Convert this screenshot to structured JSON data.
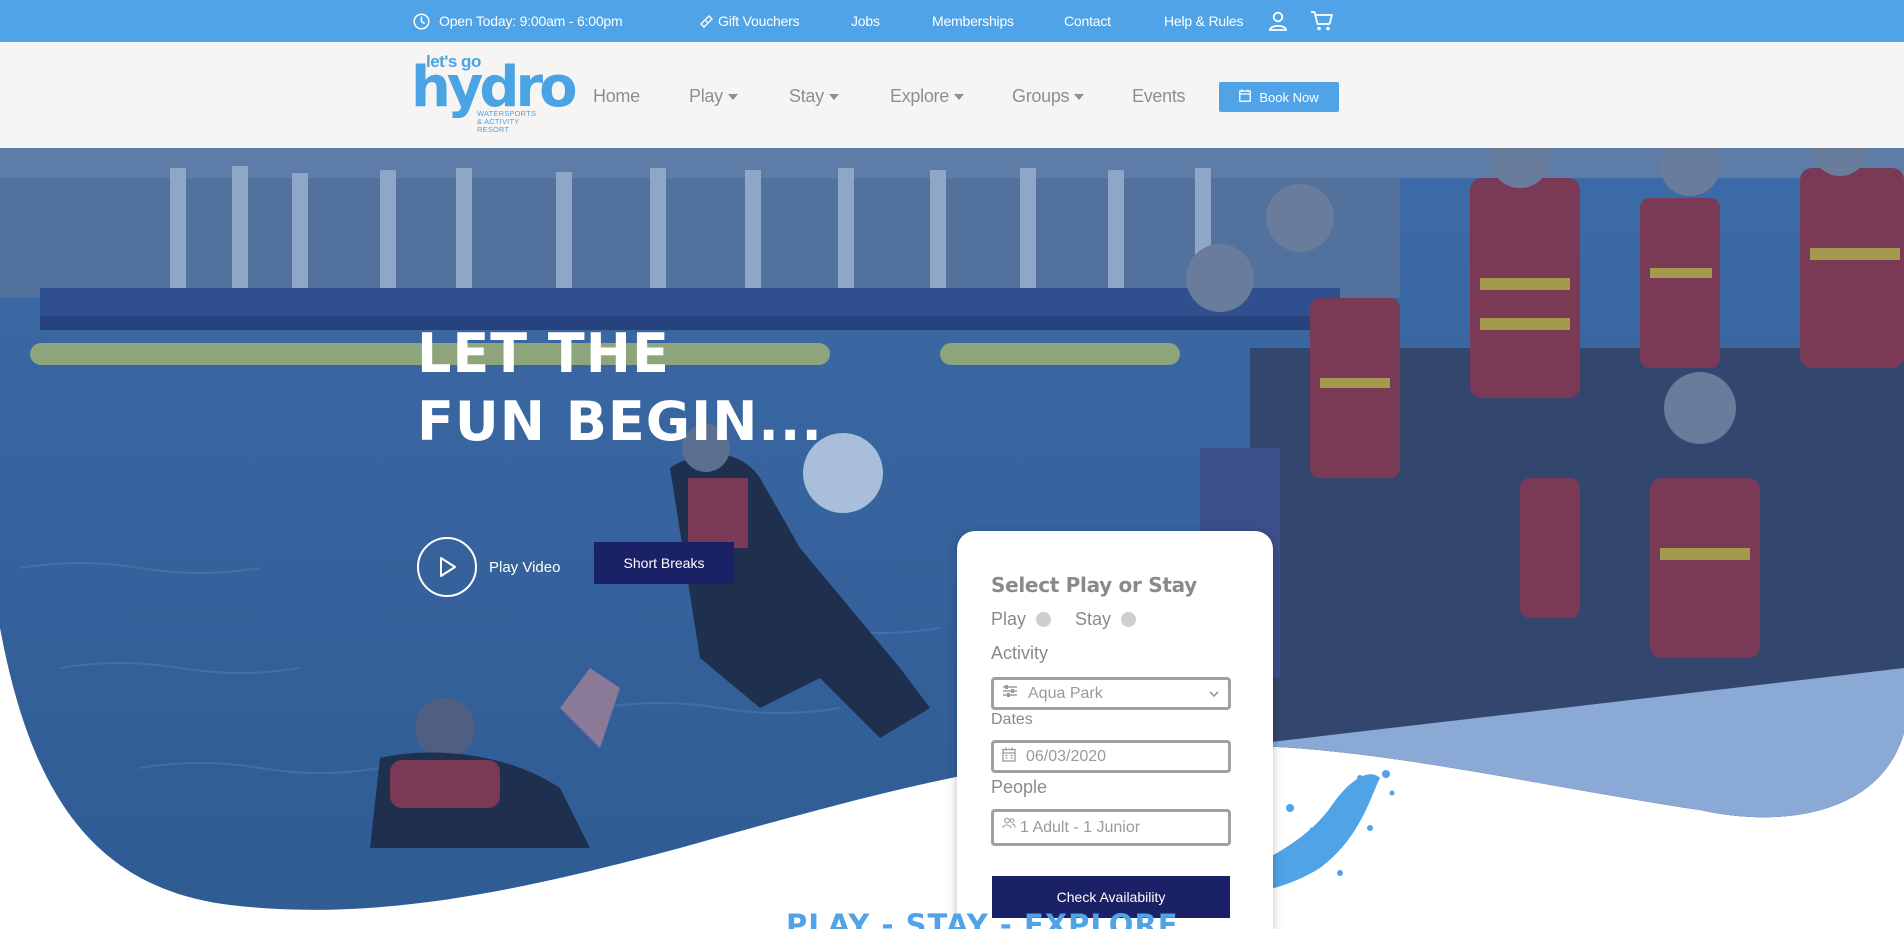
{
  "topbar": {
    "open_today": "Open Today: 9:00am - 6:00pm",
    "links": [
      "Gift Vouchers",
      "Jobs",
      "Memberships",
      "Contact",
      "Help & Rules"
    ]
  },
  "logo": {
    "lets_go": "let's go",
    "hydro": "hydro",
    "tagline_1": "WATERSPORTS",
    "tagline_2": "& ACTIVITY",
    "tagline_3": "RESORT"
  },
  "nav": {
    "items": [
      "Home",
      "Play",
      "Stay",
      "Explore",
      "Groups",
      "Events"
    ],
    "book_now": "Book Now"
  },
  "hero": {
    "headline_line1": "LET THE",
    "headline_line2": "FUN BEGIN...",
    "play_video": "Play Video",
    "short_breaks": "Short Breaks"
  },
  "booking": {
    "title": "Select Play or Stay",
    "option_play": "Play",
    "option_stay": "Stay",
    "activity_label": "Activity",
    "activity_value": "Aqua Park",
    "dates_label": "Dates",
    "dates_value": "06/03/2020",
    "people_label": "People",
    "people_placeholder": "1 Adult - 1 Junior",
    "check_availability": "Check Availability"
  },
  "section": {
    "heading": "PLAY - STAY - EXPLORE"
  },
  "colors": {
    "brand_blue": "#4fa3e6",
    "navy": "#1b2167",
    "hero_overlay": "#3f6fa7"
  }
}
